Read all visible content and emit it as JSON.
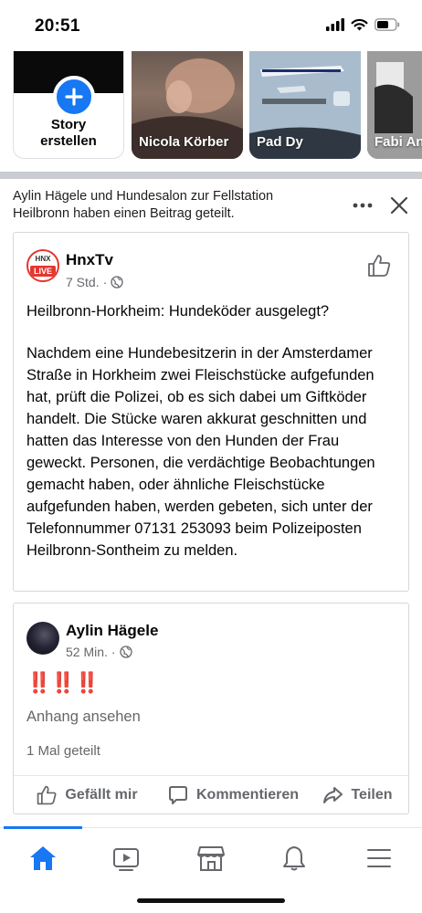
{
  "status_bar": {
    "time": "20:51"
  },
  "stories": [
    {
      "label": "Story erstellen",
      "type": "create"
    },
    {
      "label": "Nicola Körber"
    },
    {
      "label": "Pad Dy"
    },
    {
      "label": "Fabi An"
    }
  ],
  "share_header": {
    "text": "Aylin Hägele und Hundesalon zur Fellstation Heilbronn haben einen Beitrag geteilt."
  },
  "post": {
    "author": "HnxTv",
    "logo_badge": "LIVE",
    "logo_text": "HNX",
    "time": "7 Std.",
    "title": "Heilbronn-Horkheim: Hundeköder ausgelegt?",
    "body": "Nachdem eine Hundebesitzerin in der Amsterdamer Straße in Horkheim zwei Fleischstücke aufgefunden hat, prüft die Polizei, ob es sich dabei um Giftköder handelt. Die Stücke waren akkurat geschnitten und hatten das Interesse von den Hunden der Frau geweckt. Personen, die verdächtige Beobachtungen gemacht haben, oder ähnliche Fleischstücke aufgefunden haben, werden gebeten, sich unter der Telefonnummer 07131 253093 beim Polizeiposten Heilbronn-Sontheim zu melden."
  },
  "share_post": {
    "author": "Aylin Hägele",
    "time": "52 Min.",
    "text": "‼️‼️‼️",
    "attachment_link": "Anhang ansehen",
    "shares": "1 Mal geteilt"
  },
  "actions": {
    "like": "Gefällt mir",
    "comment": "Kommentieren",
    "share": "Teilen"
  },
  "colors": {
    "accent": "#1877f2",
    "secondary_text": "#65676b",
    "divider": "#c9ccd1"
  },
  "bottom_nav": [
    "home-icon",
    "video-icon",
    "marketplace-icon",
    "notifications-icon",
    "menu-icon"
  ]
}
